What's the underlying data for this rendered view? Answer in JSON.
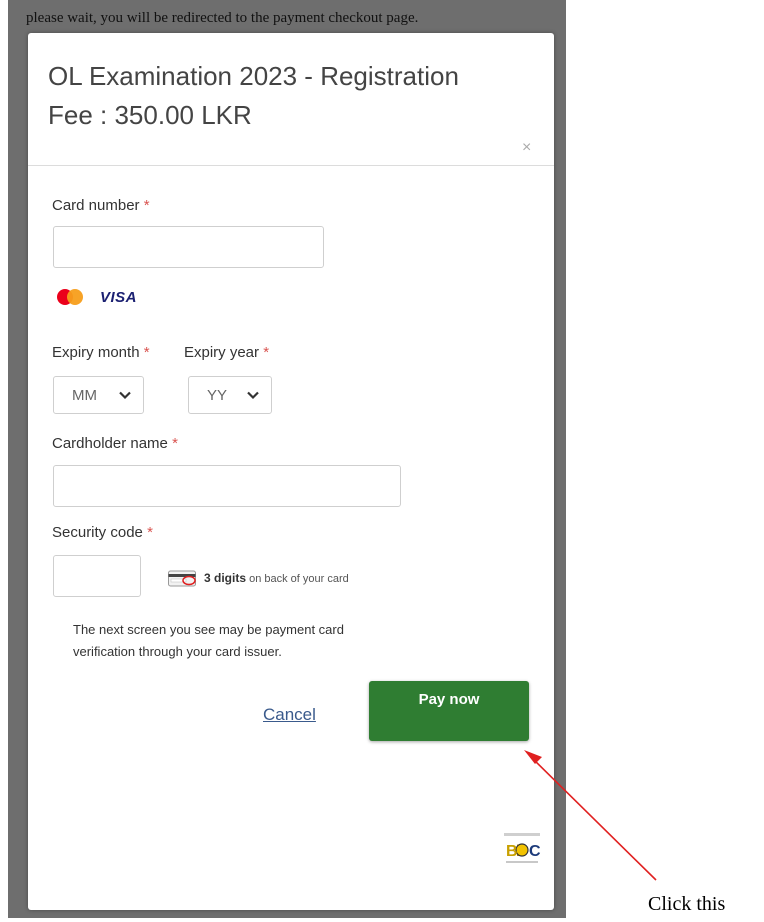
{
  "redirect_message": "please wait, you will be redirected to the payment checkout page.",
  "modal": {
    "title_line1": "OL Examination 2023 - Registration",
    "title_line2": "Fee : 350.00 LKR",
    "close_symbol": "×"
  },
  "form": {
    "required_mark": "*",
    "card_number": {
      "label": "Card number",
      "value": ""
    },
    "card_brands": [
      {
        "icon": "mastercard-icon"
      },
      {
        "icon": "visa-icon",
        "text": "VISA"
      }
    ],
    "expiry_month": {
      "label": "Expiry month",
      "selected": "MM"
    },
    "expiry_year": {
      "label": "Expiry year",
      "selected": "YY"
    },
    "cardholder_name": {
      "label": "Cardholder name",
      "value": ""
    },
    "security_code": {
      "label": "Security code",
      "value": "",
      "hint_bold": "3 digits",
      "hint_rest": "on back of your card"
    }
  },
  "notice_line1": "The next screen you see may be payment card",
  "notice_line2": "verification through your card issuer.",
  "actions": {
    "cancel_label": "Cancel",
    "pay_label": "Pay now"
  },
  "annotation": {
    "label": "Click this"
  },
  "colors": {
    "pay_button": "#2f7d32",
    "required": "#d9534f",
    "arrow": "#e02020",
    "backdrop": "#6e6e6e"
  }
}
